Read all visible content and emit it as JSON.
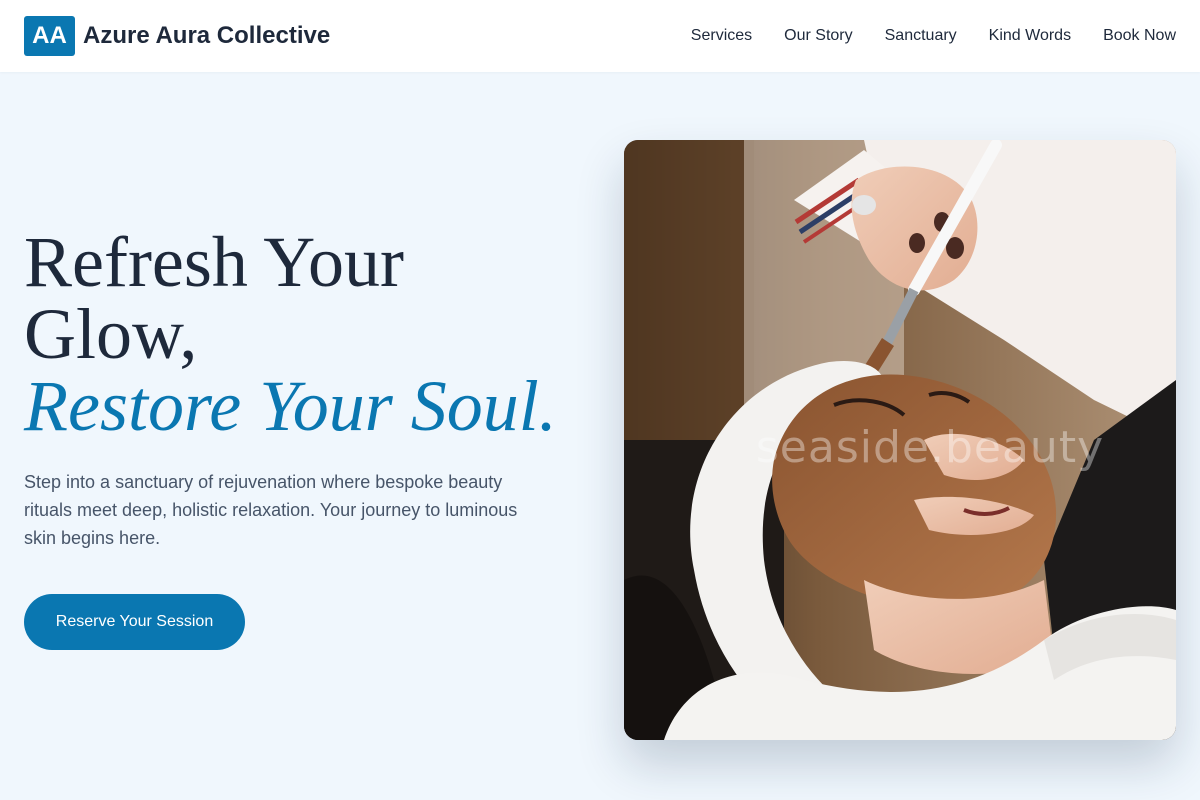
{
  "brand": {
    "logo_text": "AA",
    "name": "Azure Aura Collective"
  },
  "nav": {
    "items": [
      {
        "label": "Services"
      },
      {
        "label": "Our Story"
      },
      {
        "label": "Sanctuary"
      },
      {
        "label": "Kind Words"
      },
      {
        "label": "Book Now"
      }
    ]
  },
  "hero": {
    "title_line1": "Refresh Your",
    "title_line2": "Glow,",
    "title_accent": "Restore Your Soul.",
    "description": "Step into a sanctuary of rejuvenation where bespoke beauty rituals meet deep, holistic relaxation. Your journey to luminous skin begins here.",
    "cta_label": "Reserve Your Session",
    "image_watermark": "seaside.beauty"
  },
  "colors": {
    "accent": "#0a77b1",
    "background": "#f0f7fd",
    "text_dark": "#1e293b",
    "text_muted": "#475569"
  }
}
